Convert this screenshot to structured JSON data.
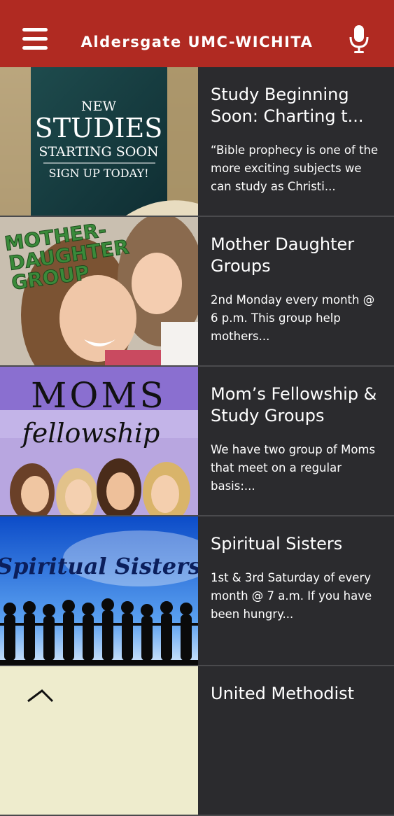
{
  "header": {
    "title": "Aldersgate UMC-WICHITA",
    "menu_icon": "hamburger-menu-icon",
    "mic_icon": "microphone-icon",
    "background_color": "#b02a22"
  },
  "items": [
    {
      "title": "Study Beginning Soon: Charting t...",
      "description": "“Bible prophecy is one of the more exciting subjects we can study as Christi...",
      "thumb_text": [
        "NEW",
        "STUDIES",
        "STARTING SOON",
        "SIGN UP TODAY!"
      ]
    },
    {
      "title": "Mother Daughter Groups",
      "description": "2nd Monday every month @ 6 p.m. This group help mothers...",
      "thumb_text": [
        "MOTHER-",
        "DAUGHTER",
        "GROUP"
      ]
    },
    {
      "title": "Mom’s Fellowship & Study Groups",
      "description": "We have two group of Moms that meet on a regular basis:...",
      "thumb_text": [
        "MOMS",
        "fellowship"
      ]
    },
    {
      "title": "Spiritual Sisters",
      "description": "1st & 3rd Saturday of every month @ 7 a.m. If you have been hungry...",
      "thumb_text": [
        "Spiritual Sisters"
      ]
    },
    {
      "title": "United Methodist",
      "description": ""
    }
  ]
}
